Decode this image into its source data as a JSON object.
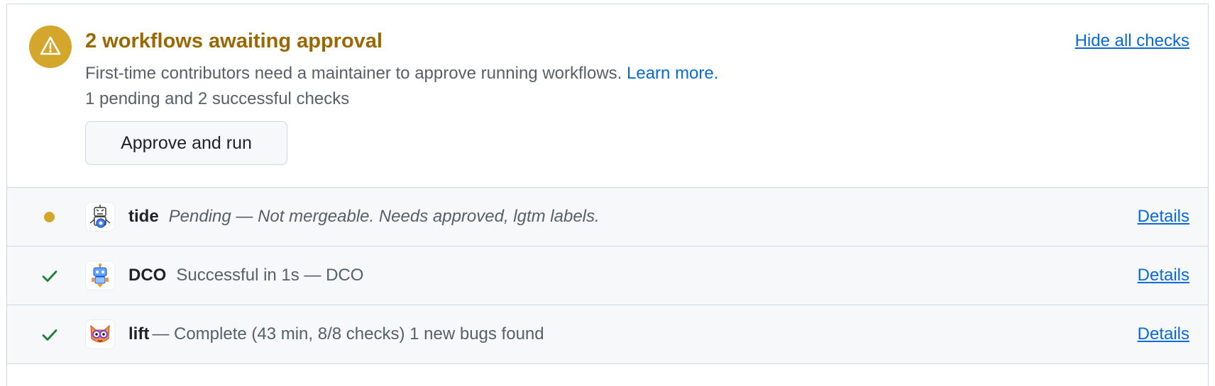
{
  "approval": {
    "title": "2 workflows awaiting approval",
    "description": "First-time contributors need a maintainer to approve running workflows.",
    "learn_more": "Learn more.",
    "summary": "1 pending and 2 successful checks",
    "approve_button": "Approve and run",
    "hide_checks": "Hide all checks",
    "icon": "alert-icon",
    "color": "#d4a72c"
  },
  "checks": [
    {
      "status": "pending",
      "status_icon": "pending-dot-icon",
      "avatar": "tide-bot-avatar",
      "name": "tide",
      "separator": "",
      "description": "Pending — Not mergeable. Needs approved, lgtm labels.",
      "details": "Details"
    },
    {
      "status": "success",
      "status_icon": "check-icon",
      "avatar": "dco-bot-avatar",
      "name": "DCO",
      "separator": "",
      "description": "Successful in 1s — DCO",
      "details": "Details"
    },
    {
      "status": "success",
      "status_icon": "check-icon",
      "avatar": "lift-bot-avatar",
      "name": "lift",
      "separator": "",
      "description": "— Complete (43 min, 8/8 checks) 1 new bugs found",
      "details": "Details"
    }
  ],
  "colors": {
    "link": "#0969da",
    "warning": "#9a6700",
    "success": "#1a7f37",
    "muted": "#57606a"
  }
}
